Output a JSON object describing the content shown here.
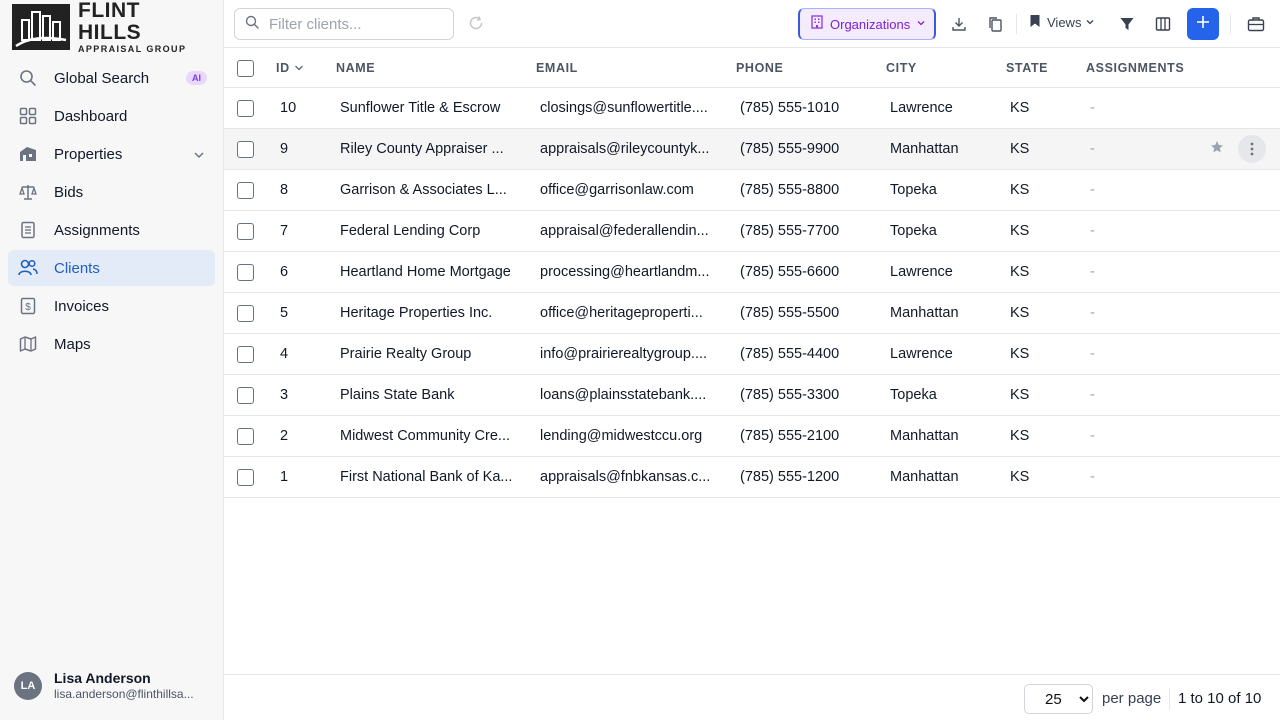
{
  "brand": {
    "name": "FLINT HILLS",
    "tagline": "APPRAISAL GROUP"
  },
  "sidebar": {
    "items": [
      {
        "label": "Global Search",
        "badge": "AI",
        "icon": "search-icon"
      },
      {
        "label": "Dashboard",
        "icon": "dashboard-icon"
      },
      {
        "label": "Properties",
        "icon": "home-icon"
      },
      {
        "label": "Bids",
        "icon": "scale-icon"
      },
      {
        "label": "Assignments",
        "icon": "clipboard-icon"
      },
      {
        "label": "Clients",
        "icon": "users-icon",
        "active": true
      },
      {
        "label": "Invoices",
        "icon": "invoice-icon"
      },
      {
        "label": "Maps",
        "icon": "map-icon"
      }
    ],
    "user": {
      "initials": "LA",
      "name": "Lisa Anderson",
      "email": "lisa.anderson@flinthillsa..."
    }
  },
  "toolbar": {
    "search_placeholder": "Filter clients...",
    "org_label": "Organizations",
    "views_label": "Views"
  },
  "table": {
    "headers": {
      "id": "ID",
      "name": "NAME",
      "email": "EMAIL",
      "phone": "PHONE",
      "city": "CITY",
      "state": "STATE",
      "assignments": "ASSIGNMENTS"
    },
    "rows": [
      {
        "id": "10",
        "name": "Sunflower Title & Escrow",
        "email": "closings@sunflowertitle....",
        "phone": "(785) 555-1010",
        "city": "Lawrence",
        "state": "KS",
        "assignments": "-"
      },
      {
        "id": "9",
        "name": "Riley County Appraiser ...",
        "email": "appraisals@rileycountyk...",
        "phone": "(785) 555-9900",
        "city": "Manhattan",
        "state": "KS",
        "assignments": "-"
      },
      {
        "id": "8",
        "name": "Garrison & Associates L...",
        "email": "office@garrisonlaw.com",
        "phone": "(785) 555-8800",
        "city": "Topeka",
        "state": "KS",
        "assignments": "-"
      },
      {
        "id": "7",
        "name": "Federal Lending Corp",
        "email": "appraisal@federallendin...",
        "phone": "(785) 555-7700",
        "city": "Topeka",
        "state": "KS",
        "assignments": "-"
      },
      {
        "id": "6",
        "name": "Heartland Home Mortgage",
        "email": "processing@heartlandm...",
        "phone": "(785) 555-6600",
        "city": "Lawrence",
        "state": "KS",
        "assignments": "-"
      },
      {
        "id": "5",
        "name": "Heritage Properties Inc.",
        "email": "office@heritageproperti...",
        "phone": "(785) 555-5500",
        "city": "Manhattan",
        "state": "KS",
        "assignments": "-"
      },
      {
        "id": "4",
        "name": "Prairie Realty Group",
        "email": "info@prairierealtygroup....",
        "phone": "(785) 555-4400",
        "city": "Lawrence",
        "state": "KS",
        "assignments": "-"
      },
      {
        "id": "3",
        "name": "Plains State Bank",
        "email": "loans@plainsstatebank....",
        "phone": "(785) 555-3300",
        "city": "Topeka",
        "state": "KS",
        "assignments": "-"
      },
      {
        "id": "2",
        "name": "Midwest Community Cre...",
        "email": "lending@midwestccu.org",
        "phone": "(785) 555-2100",
        "city": "Manhattan",
        "state": "KS",
        "assignments": "-"
      },
      {
        "id": "1",
        "name": "First National Bank of Ka...",
        "email": "appraisals@fnbkansas.c...",
        "phone": "(785) 555-1200",
        "city": "Manhattan",
        "state": "KS",
        "assignments": "-"
      }
    ]
  },
  "pagination": {
    "per_page_value": "25",
    "per_page_label": "per page",
    "range": "1 to 10 of 10"
  },
  "colors": {
    "accent": "#2563eb",
    "active_bg": "#e3ebf8",
    "active_text": "#1f5fbf",
    "org_text": "#7e22ce",
    "ai_badge": "#e9d8fb"
  }
}
